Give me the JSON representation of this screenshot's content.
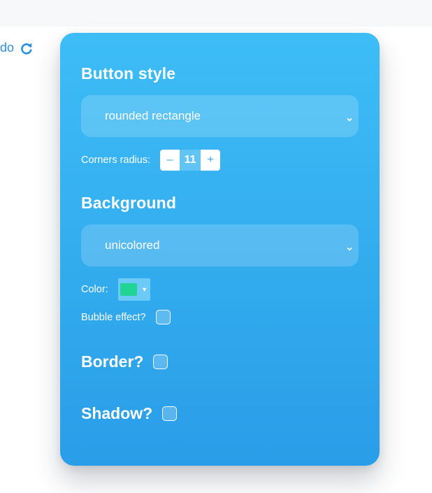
{
  "header": {
    "redo_label": "do"
  },
  "panel": {
    "button_style": {
      "heading": "Button style",
      "selected": "rounded rectangle",
      "corners_label": "Corners radius:",
      "minus": "–",
      "radius": "11",
      "plus": "+"
    },
    "background": {
      "heading": "Background",
      "selected": "unicolored",
      "color_label": "Color:",
      "color": "#1fd494",
      "caret": "▼",
      "bubble_label": "Bubble effect?"
    },
    "border": {
      "heading": "Border?"
    },
    "shadow": {
      "heading": "Shadow?"
    }
  },
  "colors": {
    "panel_top": "#3dbdf6",
    "panel_bottom": "#2a9de8",
    "link": "#2b8fe0"
  }
}
